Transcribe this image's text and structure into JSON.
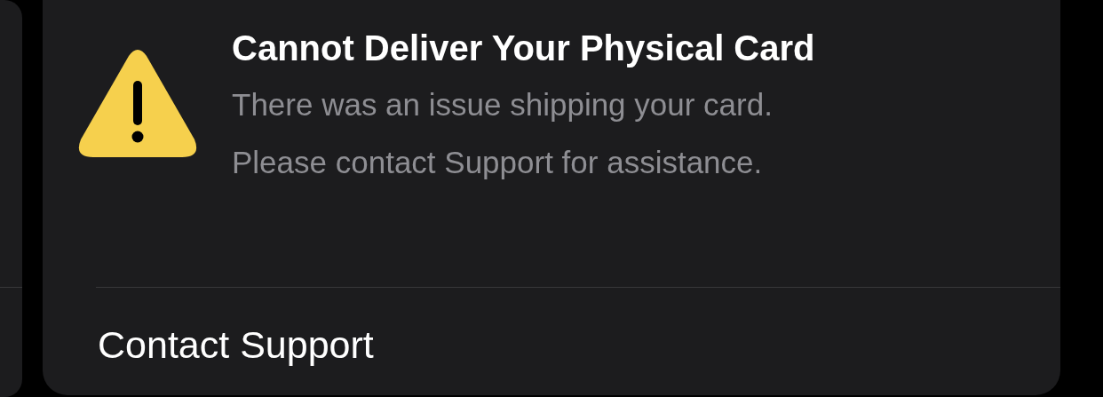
{
  "alert": {
    "title": "Cannot Deliver Your Physical Card",
    "message_lines": [
      "There was an issue shipping your card.",
      "Please contact Support for assistance."
    ]
  },
  "actions": [
    {
      "label": "Contact Support"
    }
  ]
}
